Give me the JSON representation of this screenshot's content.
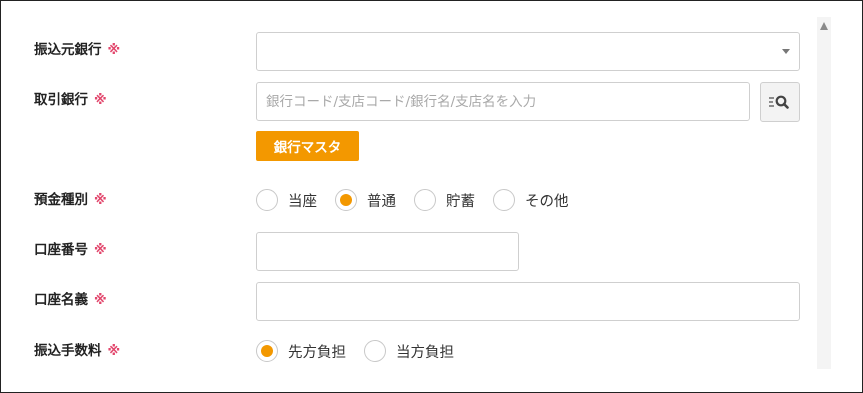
{
  "form": {
    "source_bank": {
      "label": "振込元銀行",
      "required_mark": "※",
      "selected_value": ""
    },
    "partner_bank": {
      "label": "取引銀行",
      "required_mark": "※",
      "placeholder": "銀行コード/支店コード/銀行名/支店名を入力",
      "value": "",
      "search_icon": "list-search-icon",
      "master_button_label": "銀行マスタ"
    },
    "account_type": {
      "label": "預金種別",
      "required_mark": "※",
      "options": [
        {
          "label": "当座",
          "checked": false
        },
        {
          "label": "普通",
          "checked": true
        },
        {
          "label": "貯蓄",
          "checked": false
        },
        {
          "label": "その他",
          "checked": false
        }
      ]
    },
    "account_number": {
      "label": "口座番号",
      "required_mark": "※",
      "value": ""
    },
    "account_name": {
      "label": "口座名義",
      "required_mark": "※",
      "value": ""
    },
    "transfer_fee": {
      "label": "振込手数料",
      "required_mark": "※",
      "options": [
        {
          "label": "先方負担",
          "checked": true
        },
        {
          "label": "当方負担",
          "checked": false
        }
      ]
    }
  },
  "colors": {
    "accent": "#f39800",
    "required": "#e2466c",
    "border": "#cfcfcf"
  }
}
